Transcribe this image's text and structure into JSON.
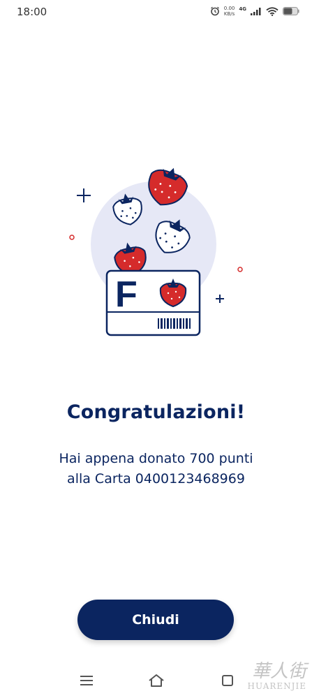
{
  "status_bar": {
    "time": "18:00",
    "speed_value": "0.00",
    "speed_unit": "KB/s",
    "network": "4G",
    "icons": [
      "alarm-icon",
      "signal-icon",
      "wifi-icon",
      "battery-icon"
    ]
  },
  "illustration": {
    "card_letter": "F",
    "colors": {
      "navy": "#0b2560",
      "strawberry_red": "#d52b2b",
      "circle_bg": "#e6e8f6"
    }
  },
  "main": {
    "title": "Congratulazioni!",
    "message_line1": "Hai appena donato 700 punti",
    "message_line2": "alla Carta 0400123468969"
  },
  "actions": {
    "close_label": "Chiudi"
  },
  "nav_bar": {
    "icons": [
      "menu-icon",
      "home-icon",
      "back-icon"
    ]
  },
  "watermark": {
    "top": "華人街",
    "bottom": "HUARENJIE"
  }
}
